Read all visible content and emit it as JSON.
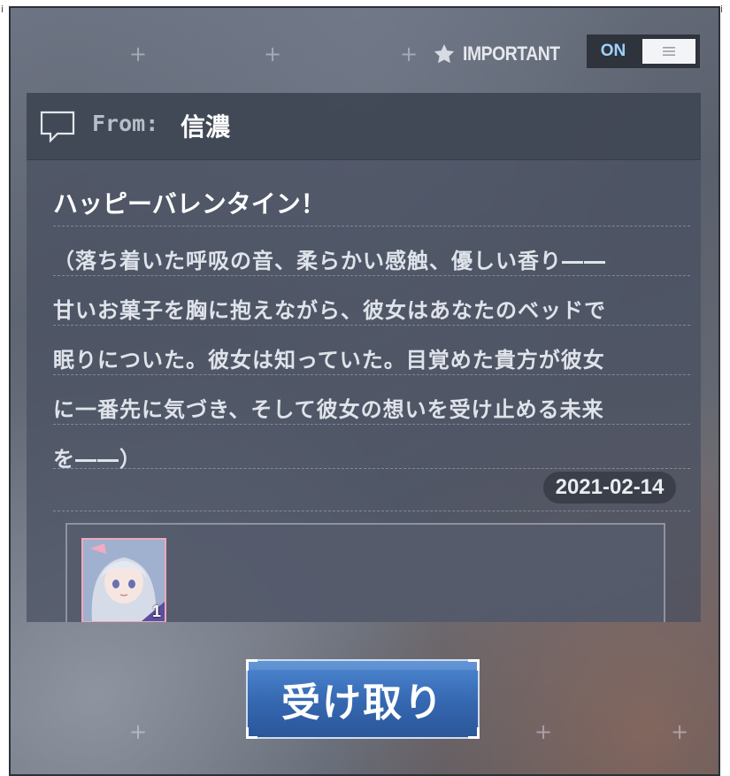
{
  "header": {
    "important_label": "IMPORTANT",
    "toggle_state": "ON",
    "star_icon": "star-icon",
    "menu_icon": "menu-icon"
  },
  "mail": {
    "from_label": "From:",
    "sender": "信濃",
    "title": "ハッピーバレンタイン！",
    "body_lines": [
      "（落ち着いた呼吸の音、柔らかい感触、優しい香り――",
      "甘いお菓子を胸に抱えながら、彼女はあなたのベッドで",
      "眠りについた。彼女は知っていた。目覚めた貴方が彼女",
      "に一番先に気づき、そして彼女の想いを受け止める未来",
      "を――）"
    ],
    "date": "2021-02-14"
  },
  "attachment": {
    "item_count": "1"
  },
  "actions": {
    "receive_label": "受け取り"
  },
  "colors": {
    "accent": "#3b73c0",
    "toggle_on_text": "#9fd2ff",
    "panel": "#484f5f"
  }
}
